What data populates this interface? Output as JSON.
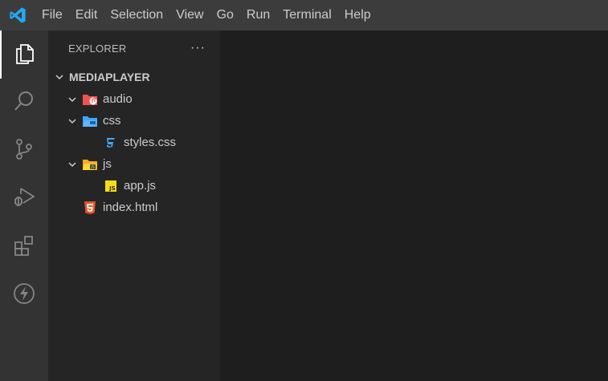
{
  "menu": [
    "File",
    "Edit",
    "Selection",
    "View",
    "Go",
    "Run",
    "Terminal",
    "Help"
  ],
  "activity_bar": [
    {
      "icon": "files-icon",
      "active": true
    },
    {
      "icon": "search-icon",
      "active": false
    },
    {
      "icon": "source-control-icon",
      "active": false
    },
    {
      "icon": "run-debug-icon",
      "active": false
    },
    {
      "icon": "extensions-icon",
      "active": false
    },
    {
      "icon": "lightning-icon",
      "active": false
    }
  ],
  "explorer": {
    "title": "EXPLORER",
    "more": "···",
    "project": "MEDIAPLAYER",
    "items": {
      "audio": "audio",
      "css": "css",
      "styles": "styles.css",
      "js": "js",
      "app": "app.js",
      "index": "index.html"
    }
  },
  "colors": {
    "titlebar": "#3c3c3c",
    "activitybar": "#333333",
    "sidebar": "#252526",
    "editor": "#1e1e1e",
    "vscode_blue": "#23a9f2",
    "html_orange": "#e44d26",
    "js_yellow": "#f5de19",
    "css_blue": "#42a5f5",
    "audio_red": "#ef5350"
  }
}
